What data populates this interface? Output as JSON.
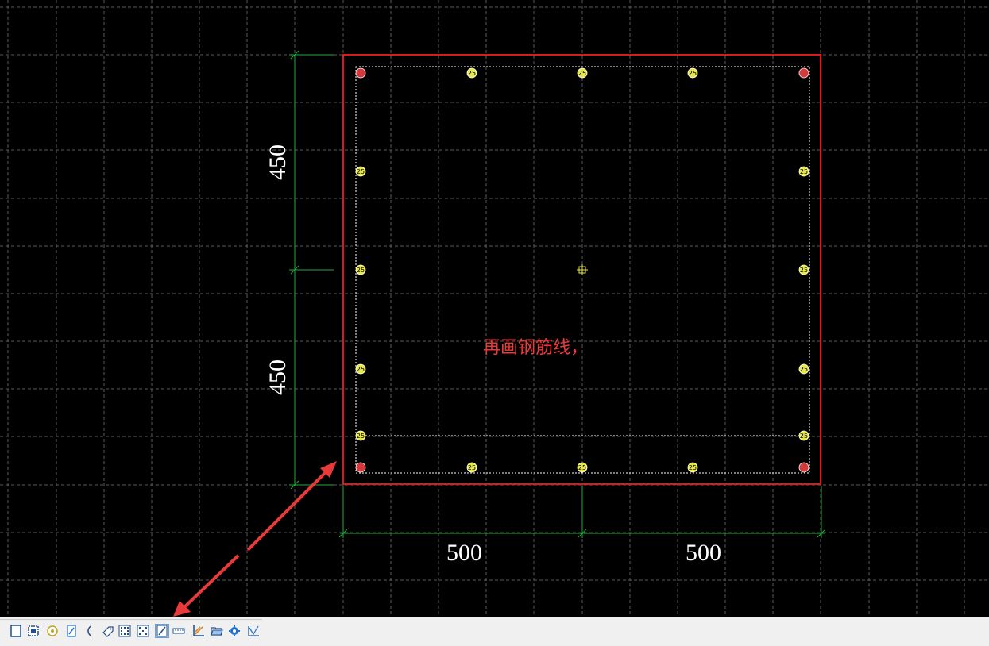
{
  "canvas": {
    "background": "#000000",
    "grid_color": "#5a5a5a",
    "section_color": "#e01818",
    "stirrup_color": "#ffffff",
    "dimension_color": "#1fae3a",
    "rebar_corner_color": "#d43a3a",
    "rebar_color": "#e8e840"
  },
  "dimensions": {
    "vertical": [
      "450",
      "450"
    ],
    "horizontal": [
      "500",
      "500"
    ]
  },
  "rebars": {
    "label": "25",
    "corner_count": 4,
    "side_count": 16
  },
  "annotation": {
    "text": "再画钢筋线，"
  },
  "toolbar": {
    "buttons": [
      {
        "name": "edge-tool-icon"
      },
      {
        "name": "rectangle-section-icon"
      },
      {
        "name": "box-section-icon"
      },
      {
        "name": "circle-section-icon"
      },
      {
        "name": "edit-section-icon"
      },
      {
        "name": "arc-icon"
      },
      {
        "name": "tag-icon"
      },
      {
        "name": "rebar-grid-icon"
      },
      {
        "name": "rebar-grid-alt-icon"
      },
      {
        "name": "draw-rebar-line-icon",
        "active": true
      },
      {
        "name": "dimension-icon"
      },
      {
        "name": "chart-axes-icon"
      },
      {
        "name": "open-folder-icon"
      },
      {
        "name": "settings-gear-icon"
      },
      {
        "name": "stress-chart-icon"
      }
    ]
  }
}
